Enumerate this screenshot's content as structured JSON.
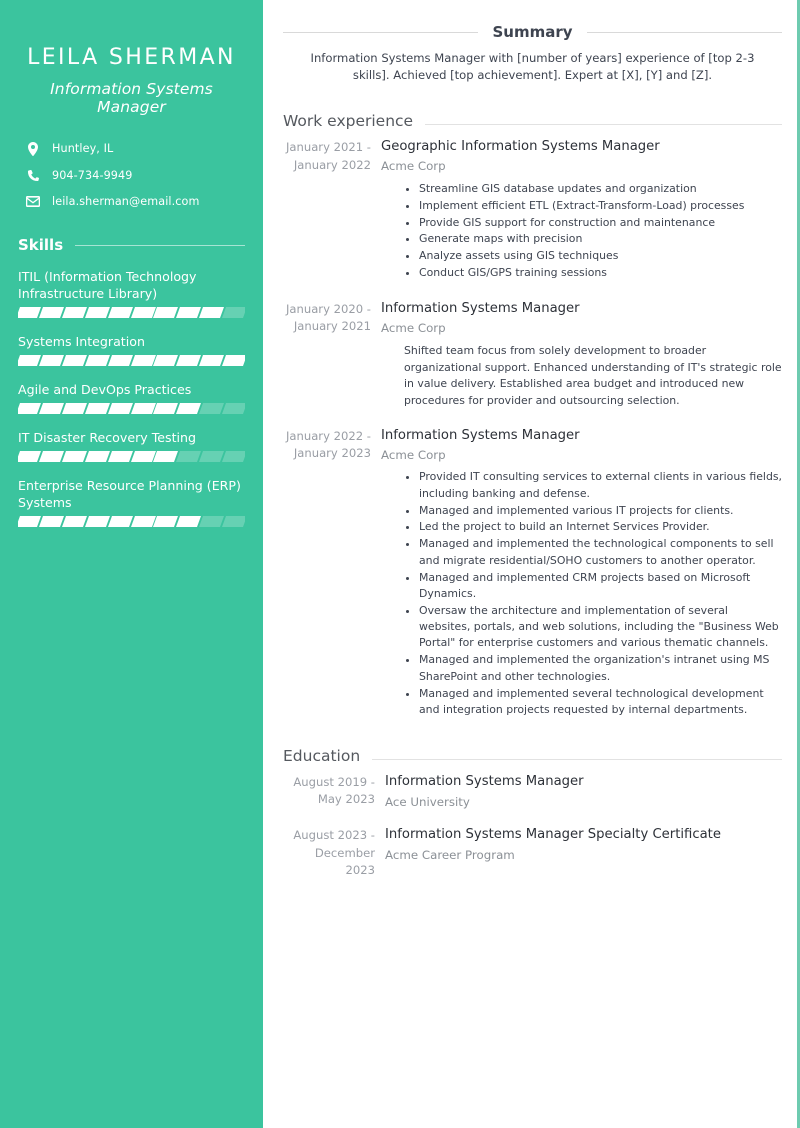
{
  "theme": {
    "sidebar_bg": "#3bc49e",
    "accent": "#3bc49e",
    "scrollbar": "#6ecbb0",
    "text_dark": "#3e4450",
    "text_muted": "#9a9ea5"
  },
  "sidebar": {
    "name": "LEILA SHERMAN",
    "job_title": "Information Systems Manager",
    "contacts": [
      {
        "icon": "location-pin-icon",
        "value": "Huntley, IL"
      },
      {
        "icon": "phone-icon",
        "value": "904-734-9949"
      },
      {
        "icon": "envelope-icon",
        "value": "leila.sherman@email.com"
      }
    ],
    "skills_heading": "Skills",
    "skills": [
      {
        "label": "ITIL (Information Technology Infrastructure Library)",
        "level": 9,
        "max": 10
      },
      {
        "label": "Systems Integration",
        "level": 10,
        "max": 10
      },
      {
        "label": "Agile and DevOps Practices",
        "level": 8,
        "max": 10
      },
      {
        "label": "IT Disaster Recovery Testing",
        "level": 7,
        "max": 10
      },
      {
        "label": "Enterprise Resource Planning (ERP) Systems",
        "level": 8,
        "max": 10
      }
    ]
  },
  "main": {
    "summary": {
      "title": "Summary",
      "body": "Information Systems Manager with [number of years] experience of [top 2-3 skills]. Achieved [top achievement]. Expert at [X], [Y] and [Z]."
    },
    "work_experience": {
      "title": "Work experience",
      "entries": [
        {
          "dates": "January 2021 - January 2022",
          "role": "Geographic Information Systems Manager",
          "org": "Acme Corp",
          "bullets": [
            "Streamline GIS database updates and organization",
            "Implement efficient ETL (Extract-Transform-Load) processes",
            "Provide GIS support for construction and maintenance",
            "Generate maps with precision",
            "Analyze assets using GIS techniques",
            "Conduct GIS/GPS training sessions"
          ]
        },
        {
          "dates": "January 2020 - January 2021",
          "role": "Information Systems Manager",
          "org": "Acme Corp",
          "description": "Shifted team focus from solely development to broader organizational support. Enhanced understanding of IT's strategic role in value delivery. Established area budget and introduced new procedures for provider and outsourcing selection."
        },
        {
          "dates": "January 2022 - January 2023",
          "role": "Information Systems Manager",
          "org": "Acme Corp",
          "bullets": [
            "Provided IT consulting services to external clients in various fields, including banking and defense.",
            "Managed and implemented various IT projects for clients.",
            "Led the project to build an Internet Services Provider.",
            "Managed and implemented the technological components to sell and migrate residential/SOHO customers to another operator.",
            "Managed and implemented CRM projects based on Microsoft Dynamics.",
            "Oversaw the architecture and implementation of several websites, portals, and web solutions, including the \"Business Web Portal\" for enterprise customers and various thematic channels.",
            "Managed and implemented the organization's intranet using MS SharePoint and other technologies.",
            "Managed and implemented several technological development and integration projects requested by internal departments."
          ]
        }
      ]
    },
    "education": {
      "title": "Education",
      "entries": [
        {
          "dates": "August 2019 - May 2023",
          "degree": "Information Systems Manager",
          "school": "Ace University"
        },
        {
          "dates": "August 2023 - December 2023",
          "degree": "Information Systems Manager Specialty Certificate",
          "school": "Acme Career Program"
        }
      ]
    }
  }
}
